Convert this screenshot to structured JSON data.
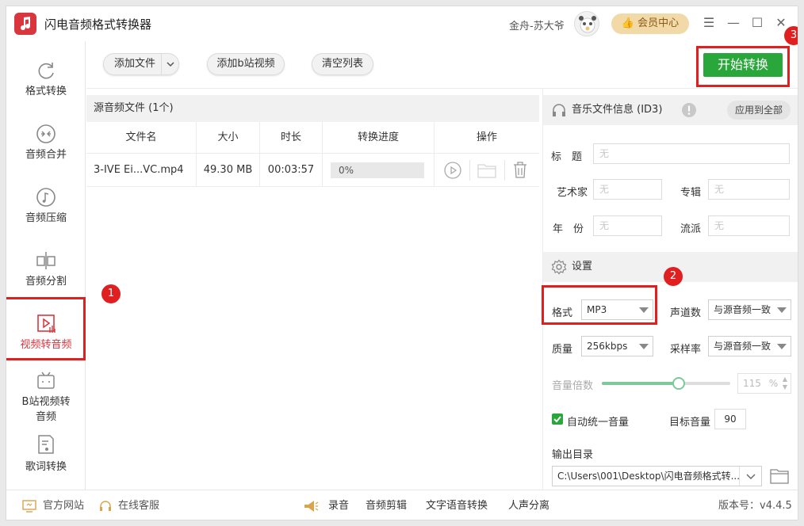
{
  "app": {
    "title": "闪电音频格式转换器",
    "user_name": "金舟-苏大爷",
    "vip_label": "会员中心"
  },
  "window_controls": {
    "menu_icon": "menu-icon",
    "min_icon": "minimize-icon",
    "max_icon": "maximize-icon",
    "close_icon": "close-icon"
  },
  "annotations": [
    "1",
    "2",
    "3"
  ],
  "sidebar": {
    "items": [
      {
        "label": "格式转换",
        "icon": "refresh-icon"
      },
      {
        "label": "音频合并",
        "icon": "merge-icon"
      },
      {
        "label": "音频压缩",
        "icon": "music-note-icon"
      },
      {
        "label": "音频分割",
        "icon": "split-icon"
      },
      {
        "label": "视频转音频",
        "icon": "video-audio-icon",
        "active": true
      },
      {
        "label": "B站视频转音频",
        "icon": "bilibili-icon"
      },
      {
        "label": "歌词转换",
        "icon": "lyrics-icon"
      }
    ]
  },
  "toolbar": {
    "add_file": "添加文件",
    "add_bilibili": "添加b站视频",
    "clear_list": "清空列表",
    "start": "开始转换"
  },
  "filelist": {
    "header": "源音频文件 (1个)",
    "columns": [
      "文件名",
      "大小",
      "时长",
      "转换进度",
      "操作"
    ],
    "rows": [
      {
        "name": "3-IVE Ei...VC.mp4",
        "size": "49.30 MB",
        "duration": "00:03:57",
        "progress_text": "0%",
        "progress": 0
      }
    ]
  },
  "id3": {
    "title": "音乐文件信息 (ID3)",
    "apply_all": "应用到全部",
    "fields": {
      "title_label": "标　题",
      "artist_label": "艺术家",
      "album_label": "专辑",
      "year_label": "年　份",
      "genre_label": "流派",
      "placeholder": "无"
    }
  },
  "settings": {
    "title": "设置",
    "format_label": "格式",
    "format_value": "MP3",
    "channels_label": "声道数",
    "channels_value": "与源音频一致",
    "quality_label": "质量",
    "quality_value": "256kbps",
    "samplerate_label": "采样率",
    "samplerate_value": "与源音频一致",
    "volume_label": "音量倍数",
    "volume_value": "115",
    "volume_unit": "%",
    "volume_level": 0.6,
    "auto_volume_label": "自动统一音量",
    "auto_volume_checked": true,
    "target_volume_label": "目标音量",
    "target_volume_value": "90",
    "output_label": "输出目录",
    "output_path": "C:\\Users\\001\\Desktop\\闪电音频格式转..."
  },
  "bottom": {
    "website": "官方网站",
    "support": "在线客服",
    "record": "录音",
    "edit": "音频剪辑",
    "tts": "文字语音转换",
    "vocal": "人声分离",
    "version": "版本号：v4.4.5"
  },
  "colors": {
    "accent_red": "#d9363e",
    "annot_red": "#e02020",
    "green": "#2aa73a"
  }
}
